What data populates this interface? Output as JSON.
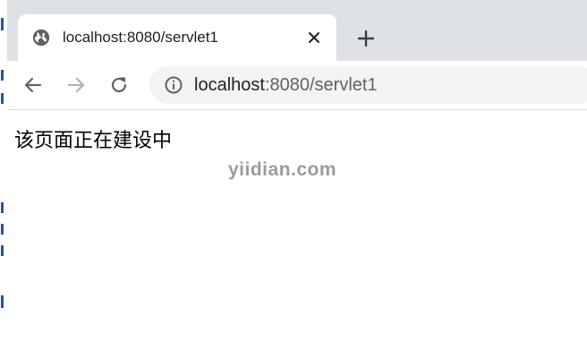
{
  "browser": {
    "tab": {
      "title": "localhost:8080/servlet1",
      "icon": "globe-icon"
    },
    "new_tab_icon": "plus-icon",
    "nav": {
      "back_icon": "arrow-left-icon",
      "forward_icon": "arrow-right-icon",
      "reload_icon": "reload-icon",
      "forward_enabled": false
    },
    "omnibox": {
      "info_icon": "info-icon",
      "url_host": "localhost",
      "url_rest": ":8080/servlet1"
    }
  },
  "page": {
    "text": "该页面正在建设中"
  },
  "watermark": "yiidian.com",
  "colors": {
    "tabstrip": "#dee1e6",
    "omnibox": "#f1f3f4",
    "icon": "#5f6368",
    "icon_disabled": "#b0b3b8"
  }
}
